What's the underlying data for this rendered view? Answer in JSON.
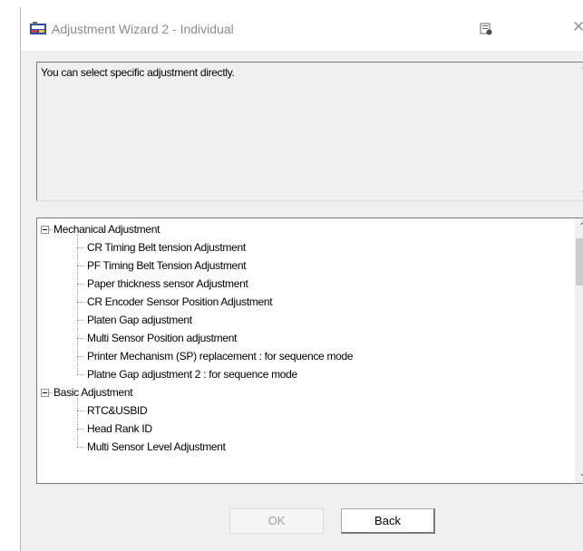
{
  "window": {
    "title": "Adjustment Wizard 2 - Individual",
    "close_glyph": "✕"
  },
  "description": {
    "text": "You can select specific adjustment directly."
  },
  "tree": {
    "groups": [
      {
        "label": "Mechanical Adjustment",
        "expanded": true,
        "items": [
          "CR Timing Belt tension Adjustment",
          "PF Timing Belt Tension Adjustment",
          "Paper thickness sensor Adjustment",
          "CR Encoder Sensor Position Adjustment",
          "Platen Gap adjustment",
          "Multi Sensor Position adjustment",
          "Printer Mechanism (SP) replacement : for sequence mode",
          "Platne Gap adjustment 2 : for sequence mode"
        ]
      },
      {
        "label": "Basic Adjustment",
        "expanded": true,
        "items": [
          "RTC&USBID",
          "Head Rank ID",
          "Multi Sensor Level Adjustment"
        ]
      }
    ]
  },
  "buttons": {
    "ok_label": "OK",
    "back_label": "Back",
    "ok_enabled": false
  },
  "icons": {
    "app": "app-icon",
    "help": "help-icon",
    "close": "close-icon"
  }
}
